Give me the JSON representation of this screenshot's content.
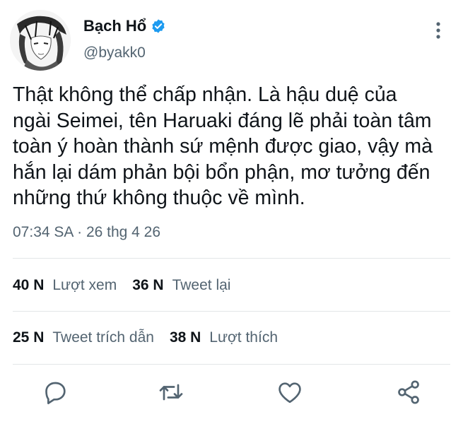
{
  "author": {
    "display_name": "Bạch Hổ",
    "handle": "@byakk0",
    "verified": true,
    "verified_color": "#1d9bf0"
  },
  "tweet": {
    "text": "Thật không thể chấp nhận. Là hậu duệ của\nngài Seimei, tên Haruaki đáng lẽ phải toàn tâm\ntoàn ý hoàn thành sứ mệnh được giao, vậy mà\nhắn lại dám phản bội bổn phận, mơ tưởng đến\nnhững thứ không thuộc về mình.",
    "time": "07:34 SA",
    "separator": "·",
    "date": "26 thg 4 26"
  },
  "stats": {
    "views": {
      "count": "40 N",
      "label": "Lượt xem"
    },
    "retweets": {
      "count": "36 N",
      "label": "Tweet lại"
    },
    "quotes": {
      "count": "25 N",
      "label": "Tweet trích dẫn"
    },
    "likes": {
      "count": "38 N",
      "label": "Lượt thích"
    }
  },
  "icons": {
    "more": "more-vertical-icon",
    "reply": "reply-icon",
    "retweet": "retweet-icon",
    "like": "heart-icon",
    "share": "share-icon"
  },
  "colors": {
    "text": "#0f1419",
    "secondary": "#536471",
    "divider": "#e3e6e8"
  }
}
